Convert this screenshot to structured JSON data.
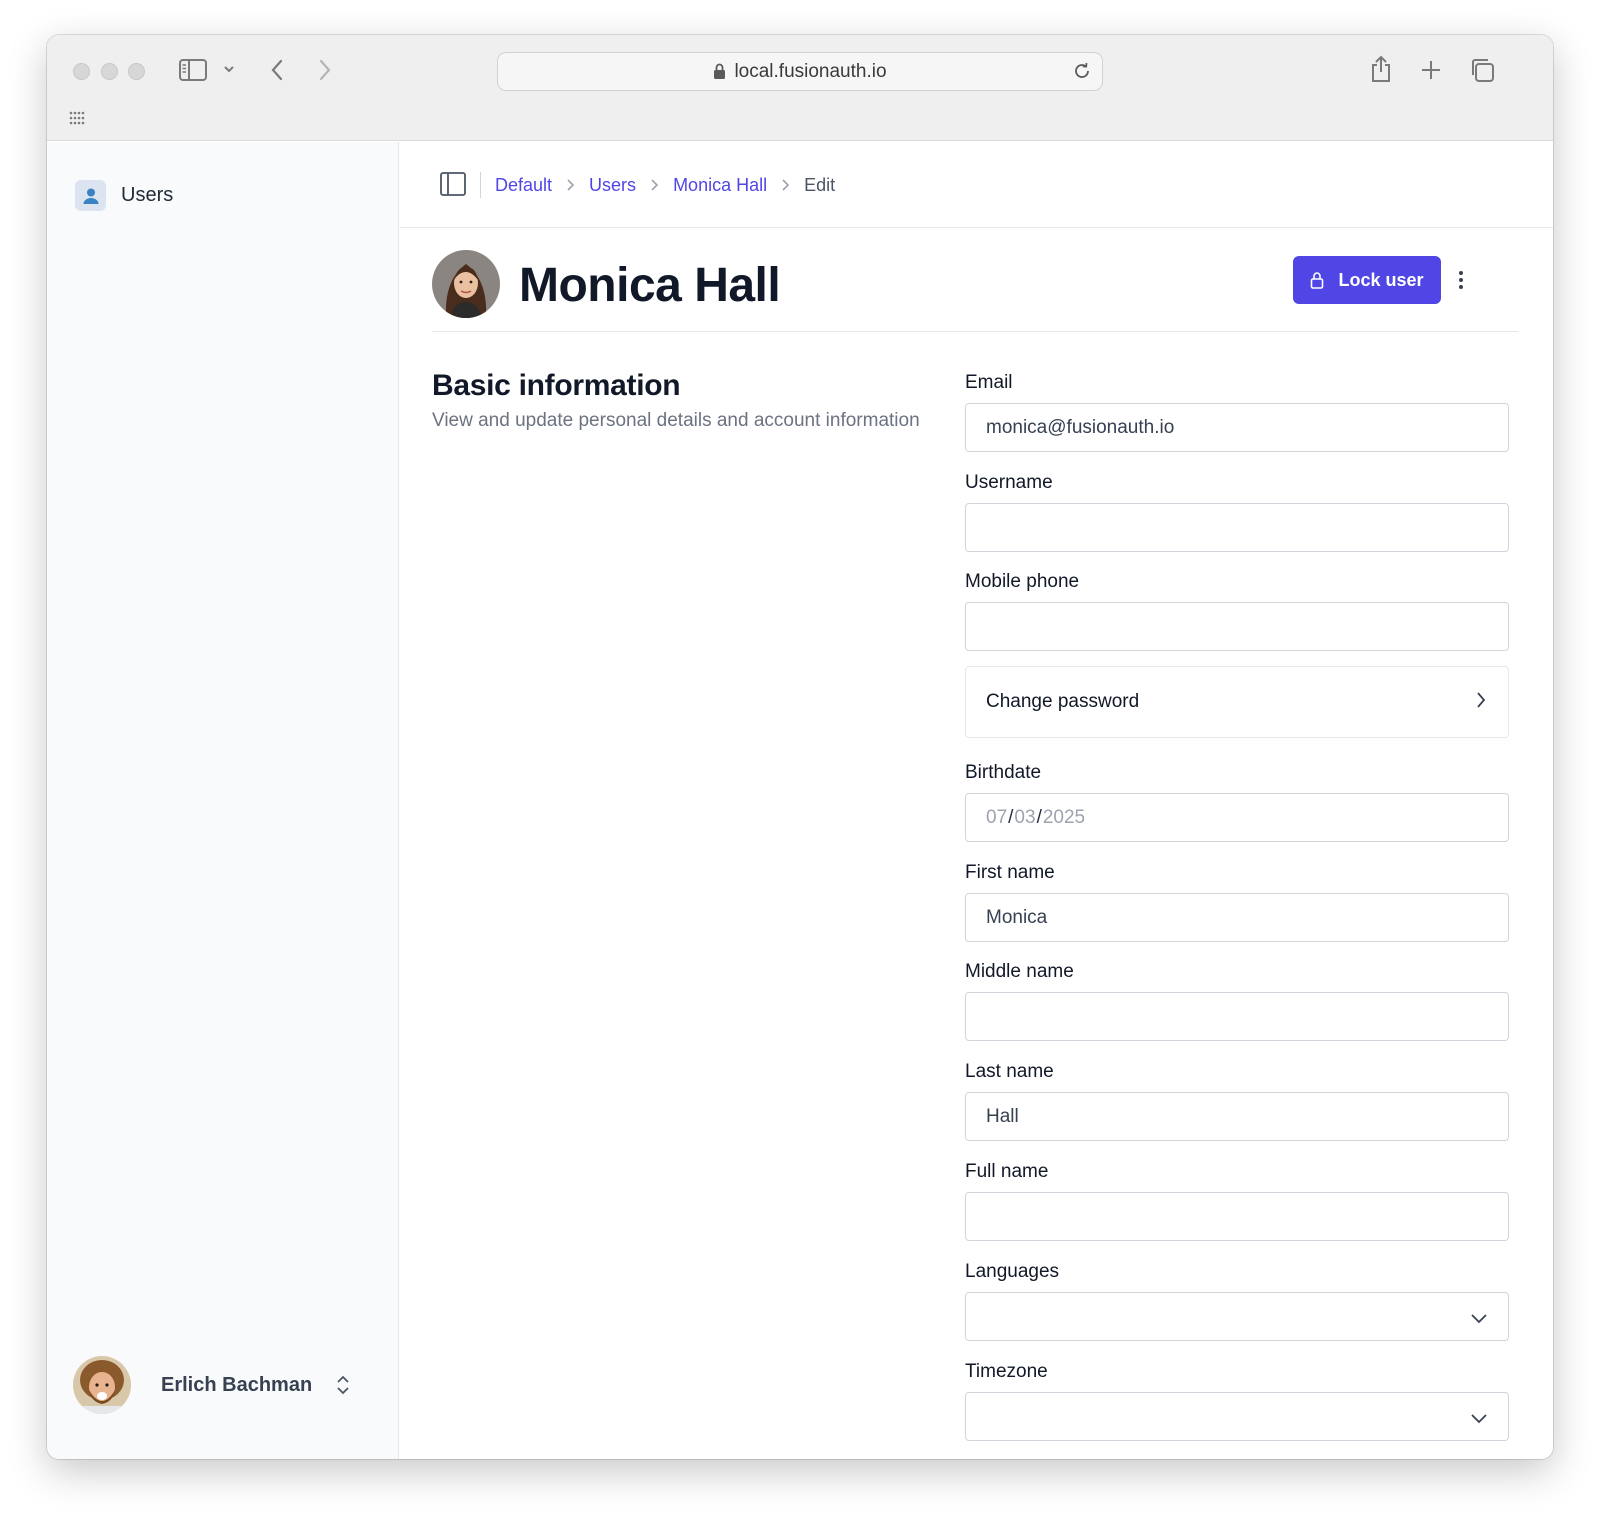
{
  "browser": {
    "url": "local.fusionauth.io"
  },
  "sidebar": {
    "items": [
      {
        "label": "Users",
        "icon": "user-icon"
      }
    ],
    "current_user": {
      "name": "Erlich Bachman"
    }
  },
  "breadcrumb": {
    "items": [
      "Default",
      "Users",
      "Monica Hall"
    ],
    "current": "Edit"
  },
  "header": {
    "title": "Monica Hall",
    "lock_button_label": "Lock user"
  },
  "section": {
    "title": "Basic information",
    "description": "View and update personal details and account information"
  },
  "form": {
    "email": {
      "label": "Email",
      "value": "monica@fusionauth.io"
    },
    "username": {
      "label": "Username",
      "value": ""
    },
    "mobile_phone": {
      "label": "Mobile phone",
      "value": ""
    },
    "change_password": {
      "label": "Change password"
    },
    "birthdate": {
      "label": "Birthdate",
      "month": "07",
      "day": "03",
      "year": "2025"
    },
    "first_name": {
      "label": "First name",
      "value": "Monica"
    },
    "middle_name": {
      "label": "Middle name",
      "value": ""
    },
    "last_name": {
      "label": "Last name",
      "value": "Hall"
    },
    "full_name": {
      "label": "Full name",
      "value": ""
    },
    "languages": {
      "label": "Languages",
      "value": ""
    },
    "timezone": {
      "label": "Timezone",
      "value": ""
    }
  },
  "colors": {
    "accent": "#4f46e5",
    "sidebar_bg": "#f9fafb",
    "chrome_bg": "#efefef"
  }
}
